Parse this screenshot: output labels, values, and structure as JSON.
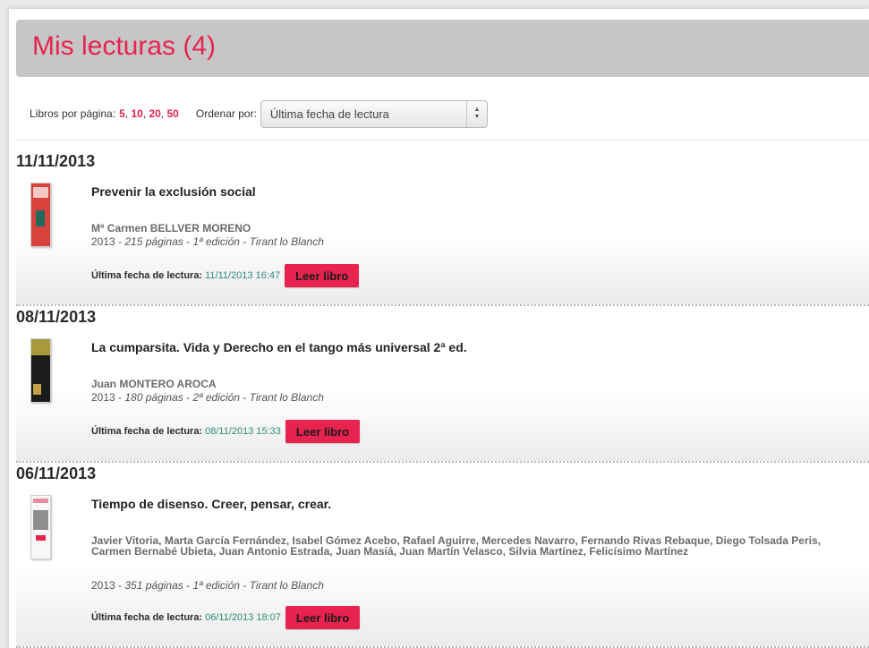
{
  "header": {
    "title": "Mis lecturas (4)"
  },
  "controls": {
    "per_page_label": "Libros por página:",
    "per_page_options": [
      "5",
      "10",
      "20",
      "50"
    ],
    "sort_label": "Ordenar por:",
    "sort_value": "Última fecha de lectura"
  },
  "groups": [
    {
      "date": "11/11/2013",
      "book": {
        "title": "Prevenir la exclusión social",
        "authors": "Mª Carmen BELLVER MORENO",
        "year": "2013",
        "pages": "215 páginas",
        "edition": "1ª edición",
        "publisher": "Tirant lo Blanch",
        "last_read_label": "Última fecha de lectura:",
        "last_read_value": "11/11/2013 16:47",
        "read_button": "Leer libro"
      }
    },
    {
      "date": "08/11/2013",
      "book": {
        "title": "La cumparsita. Vida y Derecho en el tango más universal 2ª ed.",
        "authors": "Juan MONTERO AROCA",
        "year": "2013",
        "pages": "180 páginas",
        "edition": "2ª edición",
        "publisher": "Tirant lo Blanch",
        "last_read_label": "Última fecha de lectura:",
        "last_read_value": "08/11/2013 15:33",
        "read_button": "Leer libro"
      }
    },
    {
      "date": "06/11/2013",
      "book": {
        "title": "Tiempo de disenso. Creer, pensar, crear.",
        "authors": "Javier Vitoria, Marta García Fernández, Isabel Gómez Acebo, Rafael Aguirre, Mercedes Navarro, Fernando Rivas Rebaque, Diego Tolsada Peris, Carmen Bernabé Ubieta, Juan Antonio Estrada, Juan Masiá, Juan Martín Velasco, Silvia Martínez, Felicísimo Martínez",
        "year": "2013",
        "pages": "351 páginas",
        "edition": "1ª edición",
        "publisher": "Tirant lo Blanch",
        "last_read_label": "Última fecha de lectura:",
        "last_read_value": "06/11/2013 18:07",
        "read_button": "Leer libro"
      }
    }
  ],
  "colors": {
    "accent": "#e8234f",
    "header_bg": "#c6c6c6",
    "date_value": "#2f8a7a"
  }
}
